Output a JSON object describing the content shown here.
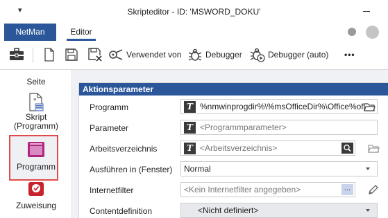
{
  "window": {
    "title": "Skripteditor - ID: 'MSWORD_DOKU'",
    "quick_access_glyph": "▾"
  },
  "ribbon": {
    "tabs": [
      {
        "label": "NetMan",
        "active": false
      },
      {
        "label": "Editor",
        "active": true
      }
    ]
  },
  "toolbar": {
    "items": [
      {
        "icon": "toolbox-icon"
      },
      {
        "icon": "new-document-icon"
      },
      {
        "icon": "save-icon"
      },
      {
        "icon": "save-close-icon"
      },
      {
        "icon": "used-by-icon",
        "label": "Verwendet von"
      },
      {
        "icon": "debugger-icon",
        "label": "Debugger"
      },
      {
        "icon": "debugger-auto-icon",
        "label": "Debugger (auto)"
      },
      {
        "icon": "more-icon",
        "label": "•••"
      }
    ]
  },
  "sidebar": {
    "heading": "Seite",
    "items": [
      {
        "label_line1": "Skript",
        "label_line2": "(Programm)",
        "icon": "script-icon",
        "selected": false
      },
      {
        "label_line1": "Programm",
        "label_line2": "",
        "icon": "program-window-icon",
        "selected": true
      },
      {
        "label_line1": "Zuweisung",
        "label_line2": "",
        "icon": "assignment-icon",
        "selected": false
      }
    ]
  },
  "panel": {
    "title": "Aktionsparameter",
    "rows": [
      {
        "label": "Programm",
        "value": "%nmwinprogdir%\\%msOfficeDir%\\Office%off",
        "placeholder": ""
      },
      {
        "label": "Parameter",
        "value": "",
        "placeholder": "<Programmparameter>"
      },
      {
        "label": "Arbeitsverzeichnis",
        "value": "",
        "placeholder": "<Arbeitsverzeichnis>"
      },
      {
        "label": "Ausführen in (Fenster)",
        "value": "Normal",
        "placeholder": ""
      },
      {
        "label": "Internetfilter",
        "value": "",
        "placeholder": "<Kein Internetfilter angegeben>",
        "button": "..."
      },
      {
        "label": "Contentdefinition",
        "value": "<Nicht definiert>",
        "placeholder": ""
      }
    ]
  },
  "colors": {
    "accent": "#2b579a",
    "highlight_border": "#e04a4a",
    "program_icon": "#b0267e"
  }
}
